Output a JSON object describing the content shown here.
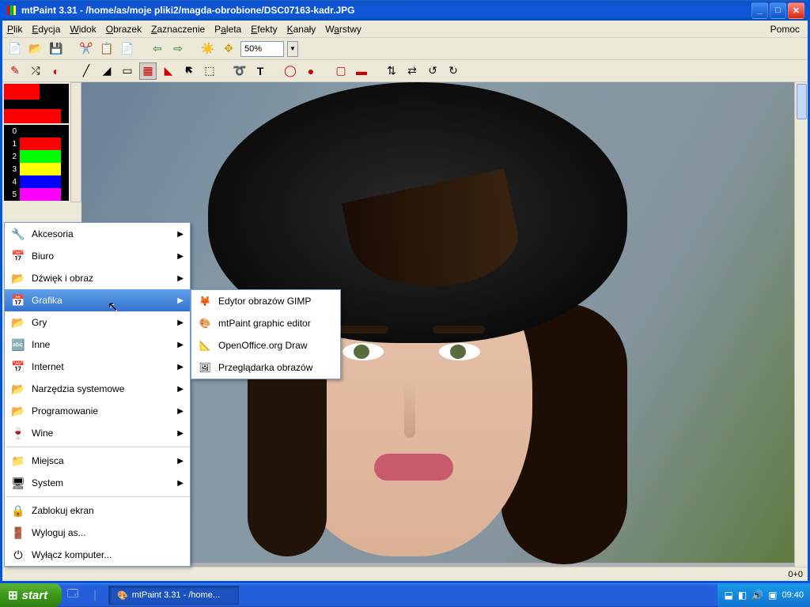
{
  "window": {
    "title": "mtPaint 3.31 - /home/as/moje pliki2/magda-obrobione/DSC07163-kadr.JPG"
  },
  "menu": {
    "items": [
      "Plik",
      "Edycja",
      "Widok",
      "Obrazek",
      "Zaznaczenie",
      "Paleta",
      "Efekty",
      "Kanały",
      "Warstwy"
    ],
    "help": "Pomoc"
  },
  "toolbar1": {
    "zoom_value": "50%"
  },
  "palette": {
    "rows": [
      {
        "n": "0",
        "c": "#000000"
      },
      {
        "n": "1",
        "c": "#ff0000"
      },
      {
        "n": "2",
        "c": "#00ff00"
      },
      {
        "n": "3",
        "c": "#ffff00"
      },
      {
        "n": "4",
        "c": "#0000ff"
      },
      {
        "n": "5",
        "c": "#ff00ff"
      }
    ]
  },
  "status": {
    "coords": "0+0"
  },
  "startmenu": {
    "items": [
      {
        "label": "Akcesoria",
        "arrow": true,
        "icon": "🔧"
      },
      {
        "label": "Biuro",
        "arrow": true,
        "icon": "📅"
      },
      {
        "label": "Dźwięk i obraz",
        "arrow": true,
        "icon": "📂"
      },
      {
        "label": "Grafika",
        "arrow": true,
        "icon": "📅",
        "hover": true
      },
      {
        "label": "Gry",
        "arrow": true,
        "icon": "📂"
      },
      {
        "label": "Inne",
        "arrow": true,
        "icon": "🔤"
      },
      {
        "label": "Internet",
        "arrow": true,
        "icon": "📅"
      },
      {
        "label": "Narzędzia systemowe",
        "arrow": true,
        "icon": "📂"
      },
      {
        "label": "Programowanie",
        "arrow": true,
        "icon": "📂"
      },
      {
        "label": "Wine",
        "arrow": true,
        "icon": "🍷"
      }
    ],
    "bottom": [
      {
        "label": "Miejsca",
        "arrow": true,
        "icon": "📁"
      },
      {
        "label": "System",
        "arrow": true,
        "icon": "🖥"
      }
    ],
    "session": [
      {
        "label": "Zablokuj ekran",
        "icon": "🔒"
      },
      {
        "label": "Wyloguj as...",
        "icon": "🚪"
      },
      {
        "label": "Wyłącz komputer...",
        "icon": "⏻"
      }
    ]
  },
  "submenu": {
    "items": [
      {
        "label": "Edytor obrazów GIMP",
        "icon": "🦊"
      },
      {
        "label": "mtPaint graphic editor",
        "icon": "🎨"
      },
      {
        "label": "OpenOffice.org Draw",
        "icon": "📐"
      },
      {
        "label": "Przeglądarka obrazów",
        "icon": "🖼"
      }
    ]
  },
  "taskbar": {
    "start": "start",
    "task1": "mtPaint 3.31 - /home...",
    "clock": "09:40"
  }
}
